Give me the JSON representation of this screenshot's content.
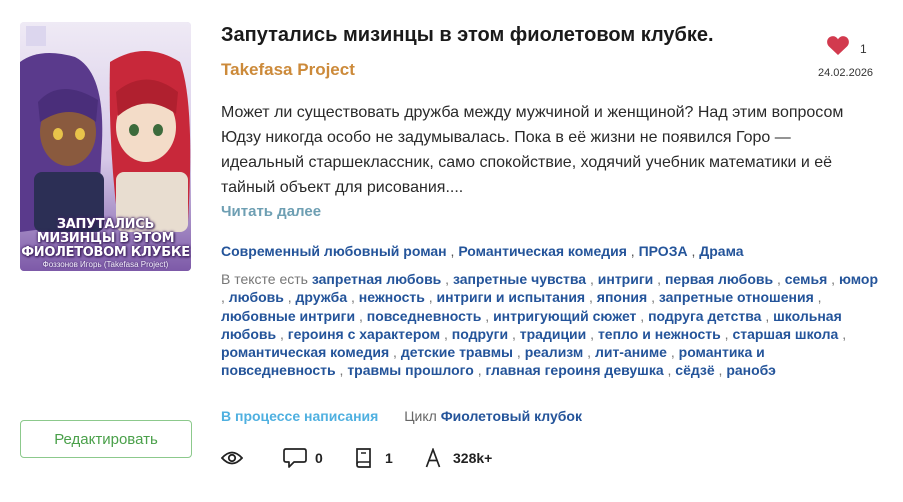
{
  "cover": {
    "title_lines": [
      "ЗАПУТАЛИСЬ",
      "МИЗИНЦЫ В ЭТОМ",
      "ФИОЛЕТОВОМ КЛУБКЕ"
    ],
    "author": "Фоззонов Игорь (Takefasa Project)"
  },
  "book": {
    "title": "Запутались мизинцы в этом фиолетовом клубке.",
    "author": "Takefasa Project",
    "likes": "1",
    "date": "24.02.2026",
    "description": "Может ли существовать дружба между мужчиной и женщиной? Над этим вопросом Юдзу никогда особо не задумывалась. Пока в её жизни не появился Горо — идеальный старшеклассник, само спокойствие, ходячий учебник математики и её тайный объект для рисования....",
    "read_more": "Читать далее"
  },
  "genres": [
    "Современный любовный роман",
    "Романтическая комедия",
    "ПРОЗА",
    "Драма"
  ],
  "tags_label": "В тексте есть",
  "tags": [
    "запретная любовь",
    "запретные чувства",
    "интриги",
    "первая любовь",
    "семья",
    "юмор",
    "любовь",
    "дружба",
    "нежность",
    "интриги и испытания",
    "япония",
    "запретные отношения",
    "любовные интриги",
    "повседневность",
    "интригующий сюжет",
    "подруга детства",
    "школьная любовь",
    "героиня с характером",
    "подруги",
    "традиции",
    "тепло и нежность",
    "старшая школа",
    "романтическая комедия",
    "детские травмы",
    "реализм",
    "лит-аниме",
    "романтика и повседневность",
    "травмы прошлого",
    "главная героиня девушка",
    "сёдзё",
    "ранобэ"
  ],
  "status": {
    "state": "В процессе написания",
    "cycle_label": "Цикл",
    "cycle_name": "Фиолетовый клубок"
  },
  "stats": {
    "views_icon": "eye-icon",
    "comments_icon": "comment-icon",
    "comments": "0",
    "chapters_icon": "book-icon",
    "chapters": "1",
    "size_icon": "letter-a-icon",
    "size": "328k+"
  },
  "actions": {
    "edit": "Редактировать"
  },
  "colors": {
    "heart": "#d23a4e",
    "author": "#cc8a3a",
    "link": "#24549a",
    "status": "#4fb0e0",
    "edit_border": "#8cc98c",
    "read_more": "#6e9fb3"
  }
}
